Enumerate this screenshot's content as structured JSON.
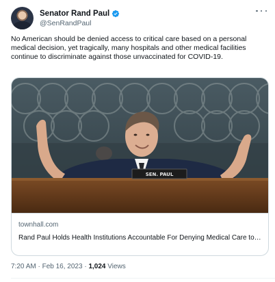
{
  "tweet": {
    "author_name": "Senator Rand Paul",
    "handle": "@SenRandPaul",
    "text": "No American should be denied access to critical care based on a personal medical decision, yet tragically, many hospitals and other medical facilities continue to discriminate against those unvaccinated for COVID-19.",
    "verified_color": "#1d9bf0"
  },
  "card": {
    "nameplate": "SEN. PAUL",
    "domain": "townhall.com",
    "title": "Rand Paul Holds Health Institutions Accountable For Denying Medical Care to the Unvaccinated"
  },
  "meta": {
    "time": "7:20 AM",
    "date": "Feb 16, 2023",
    "views_count": "1,024",
    "views_label": "Views",
    "separator": "·"
  },
  "icons": {
    "verified": "verified-badge-icon",
    "more": "more-options-icon"
  }
}
